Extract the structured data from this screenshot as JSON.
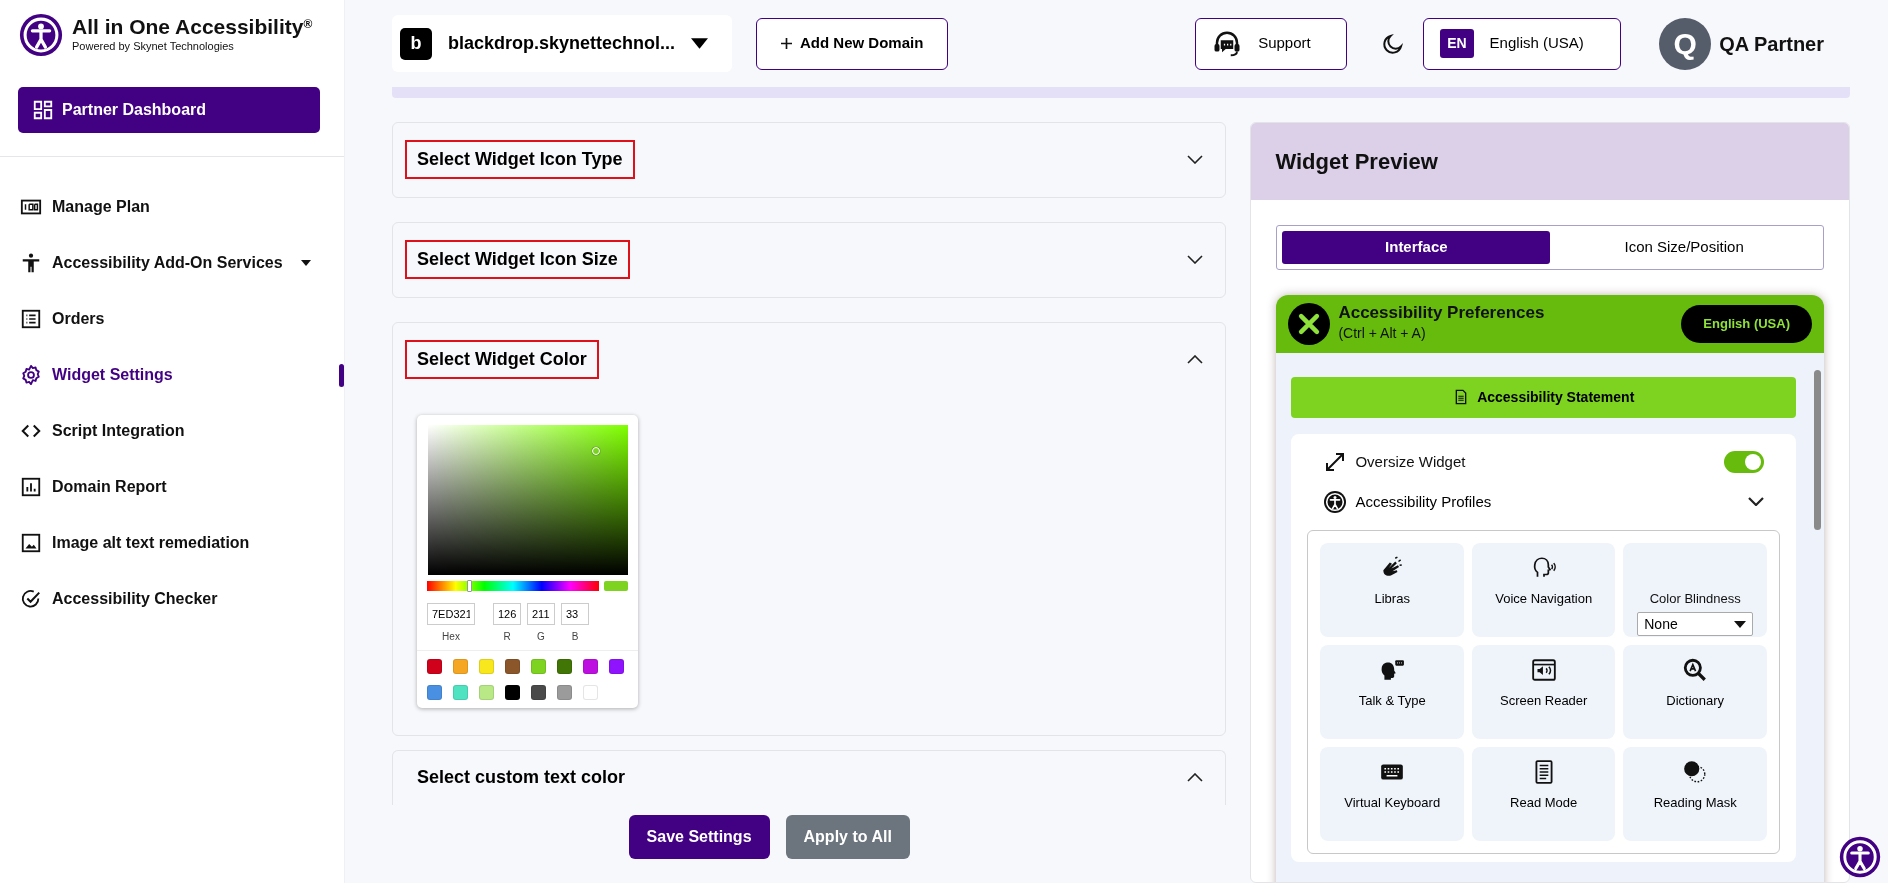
{
  "sidebar": {
    "logo": {
      "title": "All in One Accessibility",
      "mark": "®",
      "subtitle": "Powered by Skynet Technologies"
    },
    "dashboard_button": "Partner Dashboard",
    "items": [
      {
        "label": "Manage Plan",
        "selected": false,
        "has_caret": false
      },
      {
        "label": "Accessibility Add-On Services",
        "selected": false,
        "has_caret": true
      },
      {
        "label": "Orders",
        "selected": false,
        "has_caret": false
      },
      {
        "label": "Widget Settings",
        "selected": true,
        "has_caret": false
      },
      {
        "label": "Script Integration",
        "selected": false,
        "has_caret": false
      },
      {
        "label": "Domain Report",
        "selected": false,
        "has_caret": false
      },
      {
        "label": "Image alt text remediation",
        "selected": false,
        "has_caret": false
      },
      {
        "label": "Accessibility Checker",
        "selected": false,
        "has_caret": false
      }
    ]
  },
  "header": {
    "domain": {
      "initial": "b",
      "name": "blackdrop.skynettechnol..."
    },
    "add_domain": "Add New Domain",
    "support": "Support",
    "language": {
      "code": "EN",
      "name": "English (USA)"
    },
    "user": {
      "initial": "Q",
      "name": "QA Partner"
    }
  },
  "accordions": [
    {
      "title": "Select Widget Icon Type",
      "expanded": false,
      "outlined": true
    },
    {
      "title": "Select Widget Icon Size",
      "expanded": false,
      "outlined": true
    },
    {
      "title": "Select Widget Color",
      "expanded": true,
      "outlined": true
    },
    {
      "title": "Select custom text color",
      "expanded": true,
      "outlined": false
    }
  ],
  "color_picker": {
    "hue": {
      "level": 0.25
    },
    "hex": "7ED321",
    "r": "126",
    "g": "211",
    "b": "33",
    "labels": [
      "Hex",
      "R",
      "G",
      "B"
    ],
    "swatches": [
      {
        "color": "#d0021b"
      },
      {
        "color": "#f5a623"
      },
      {
        "color": "#f8e71c"
      },
      {
        "color": "#8b572a"
      },
      {
        "color": "#7ed321"
      },
      {
        "color": "#417505"
      },
      {
        "color": "#bd10e0"
      },
      {
        "color": "#9013fe"
      },
      {
        "color": "#4a90e2"
      },
      {
        "color": "#50e3c2"
      },
      {
        "color": "#b8e986"
      },
      {
        "color": "#000000"
      },
      {
        "color": "#4a4a4a"
      },
      {
        "color": "#9b9b9b"
      },
      {
        "color": "#ffffff"
      }
    ]
  },
  "actions": [
    "Save Settings",
    "Apply to All"
  ],
  "preview": {
    "title": "Widget Preview",
    "tabs": [
      {
        "label": "Interface",
        "selected": true
      },
      {
        "label": "Icon Size/Position",
        "selected": false
      }
    ],
    "widget": {
      "title": "Accessibility Preferences",
      "shortcut": "(Ctrl + Alt + A)",
      "language": "English (USA)",
      "statement": "Accessibility Statement",
      "oversize": {
        "label": "Oversize Widget",
        "on": true
      },
      "profiles": {
        "label": "Accessibility Profiles",
        "expanded": false
      },
      "tiles": [
        {
          "kind": "feature",
          "label": "Libras"
        },
        {
          "kind": "feature",
          "label": "Voice Navigation"
        },
        {
          "kind": "select",
          "label": "Color Blindness",
          "value": "None"
        },
        {
          "kind": "feature",
          "label": "Talk & Type"
        },
        {
          "kind": "feature",
          "label": "Screen Reader"
        },
        {
          "kind": "feature",
          "label": "Dictionary"
        },
        {
          "kind": "feature",
          "label": "Virtual Keyboard"
        },
        {
          "kind": "feature",
          "label": "Read Mode"
        },
        {
          "kind": "feature",
          "label": "Reading Mask"
        }
      ]
    }
  }
}
